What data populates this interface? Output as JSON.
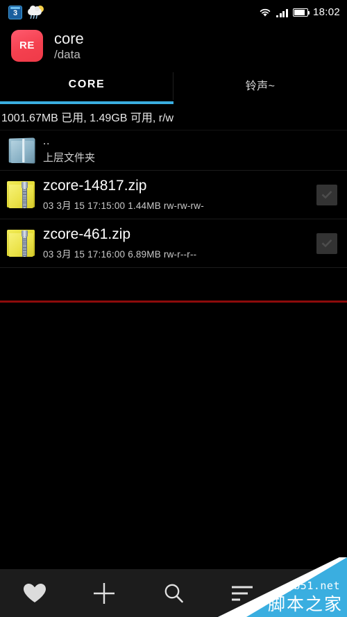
{
  "statusbar": {
    "calendar_day": "3",
    "time": "18:02",
    "icons": [
      "calendar-icon",
      "weather-icon",
      "wifi-icon",
      "signal-icon",
      "battery-icon"
    ]
  },
  "header": {
    "app_badge": "RE",
    "title": "core",
    "path": "/data"
  },
  "tabs": [
    {
      "label": "CORE",
      "active": true
    },
    {
      "label": "铃声~",
      "active": false
    }
  ],
  "storage": {
    "info": "1001.67MB 已用, 1.49GB 可用, r/w"
  },
  "files": [
    {
      "name": "..",
      "subtitle": "上层文件夹",
      "icon": "folder-icon",
      "type": "parent"
    },
    {
      "name": "zcore-14817.zip",
      "meta": "03 3月 15 17:15:00  1.44MB  rw-rw-rw-",
      "date": "03 3月 15 17:15:00",
      "size": "1.44MB",
      "permissions": "rw-rw-rw-",
      "icon": "zip-folder-icon",
      "type": "file"
    },
    {
      "name": "zcore-461.zip",
      "meta": "03 3月 15 17:16:00  6.89MB  rw-r--r--",
      "date": "03 3月 15 17:16:00",
      "size": "6.89MB",
      "permissions": "rw-r--r--",
      "icon": "zip-folder-icon",
      "type": "file"
    }
  ],
  "toolbar": {
    "items": [
      {
        "icon": "heart-icon",
        "name": "favorites-button"
      },
      {
        "icon": "plus-icon",
        "name": "add-button"
      },
      {
        "icon": "search-icon",
        "name": "search-button"
      },
      {
        "icon": "sort-icon",
        "name": "sort-button"
      },
      {
        "icon": "more-icon",
        "name": "more-button"
      }
    ]
  },
  "watermark": {
    "site": "jb51.net",
    "name": "脚本之家"
  },
  "colors": {
    "accent": "#3aaee0",
    "app_badge": "#f4404f",
    "separator_red": "#8d0b0b",
    "background": "#000000",
    "toolbar_bg": "#1c1c1c"
  }
}
